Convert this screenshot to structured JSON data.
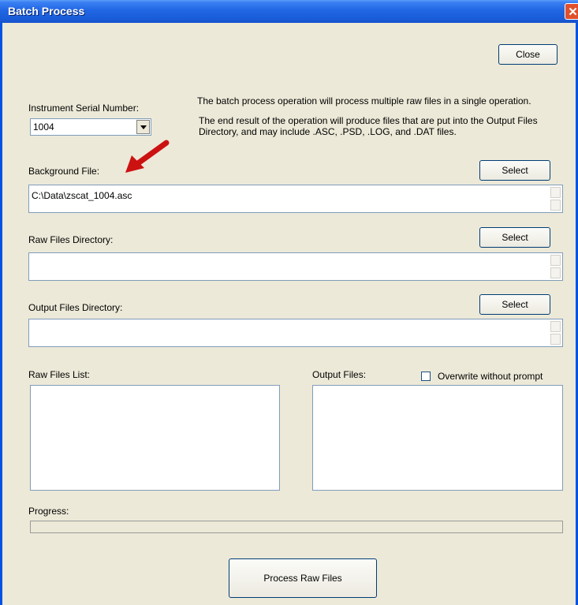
{
  "window": {
    "title": "Batch Process"
  },
  "close_button": "Close",
  "info": {
    "line1": "The batch process operation will process multiple raw files in a single operation.",
    "line2a": "The end result of the operation will produce files that are put into the Output Files",
    "line2b": "Directory, and may include .ASC, .PSD, .LOG, and .DAT files."
  },
  "serial": {
    "label": "Instrument Serial Number:",
    "value": "1004"
  },
  "background": {
    "label": "Background File:",
    "value": "C:\\Data\\zscat_1004.asc",
    "select": "Select"
  },
  "raw_dir": {
    "label": "Raw Files Directory:",
    "value": "",
    "select": "Select"
  },
  "output_dir": {
    "label": "Output Files Directory:",
    "value": "",
    "select": "Select"
  },
  "raw_list": {
    "label": "Raw Files List:"
  },
  "output_files": {
    "label": "Output Files:",
    "overwrite": "Overwrite without prompt",
    "overwrite_checked": false
  },
  "progress": {
    "label": "Progress:",
    "value": 0
  },
  "process_button": "Process Raw Files",
  "colors": {
    "titlebar": "#2166e3",
    "dialog_bg": "#ece9d8",
    "arrow": "#cc1111"
  }
}
